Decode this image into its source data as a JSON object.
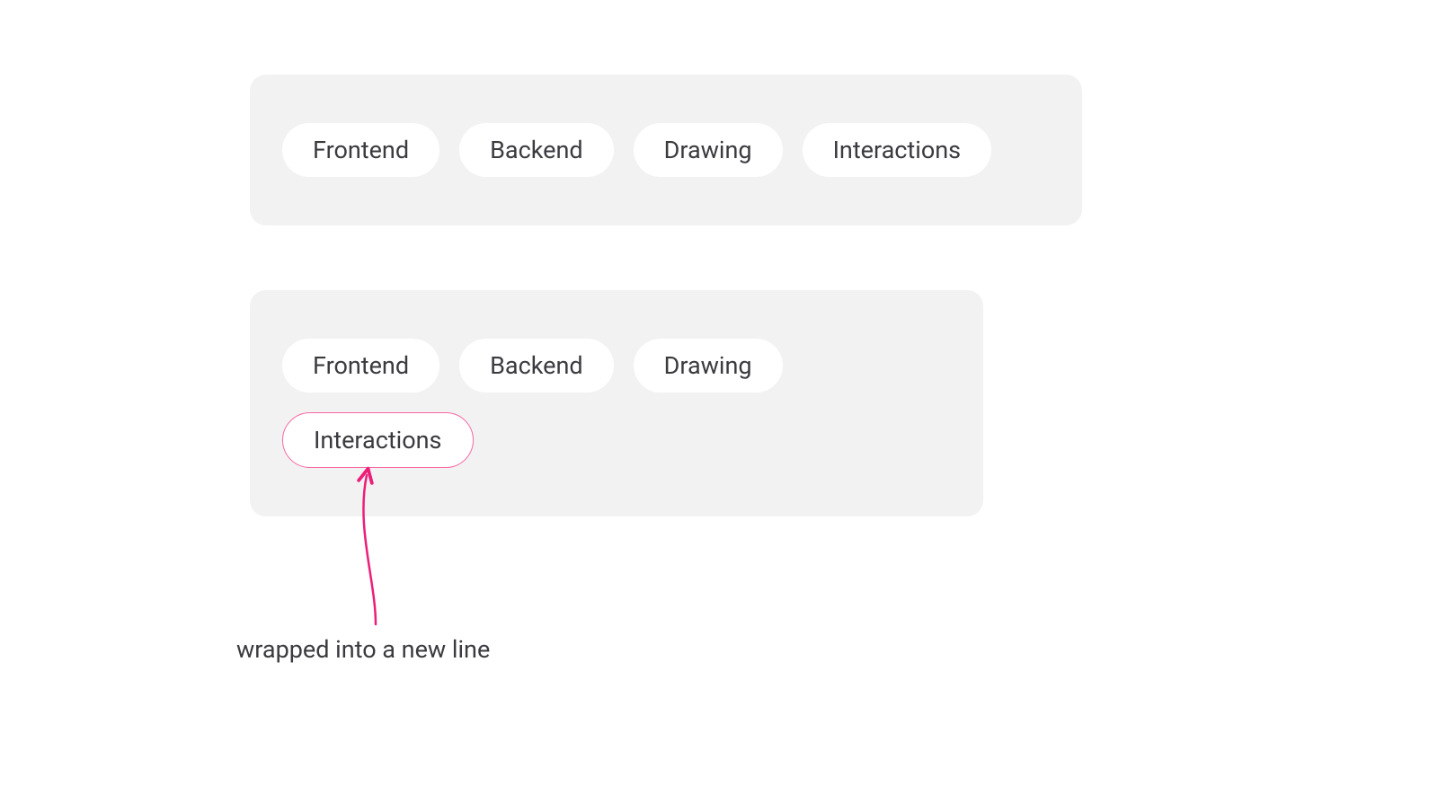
{
  "example_wide": {
    "pills": [
      {
        "label": "Frontend",
        "highlighted": false
      },
      {
        "label": "Backend",
        "highlighted": false
      },
      {
        "label": "Drawing",
        "highlighted": false
      },
      {
        "label": "Interactions",
        "highlighted": false
      }
    ]
  },
  "example_narrow": {
    "pills": [
      {
        "label": "Frontend",
        "highlighted": false
      },
      {
        "label": "Backend",
        "highlighted": false
      },
      {
        "label": "Drawing",
        "highlighted": false
      },
      {
        "label": "Interactions",
        "highlighted": true
      }
    ]
  },
  "annotation": {
    "text": "wrapped into a new line"
  },
  "colors": {
    "background_panel": "#f2f2f3",
    "pill_background": "#ffffff",
    "text": "#3a3a3f",
    "accent": "#f765a0"
  }
}
